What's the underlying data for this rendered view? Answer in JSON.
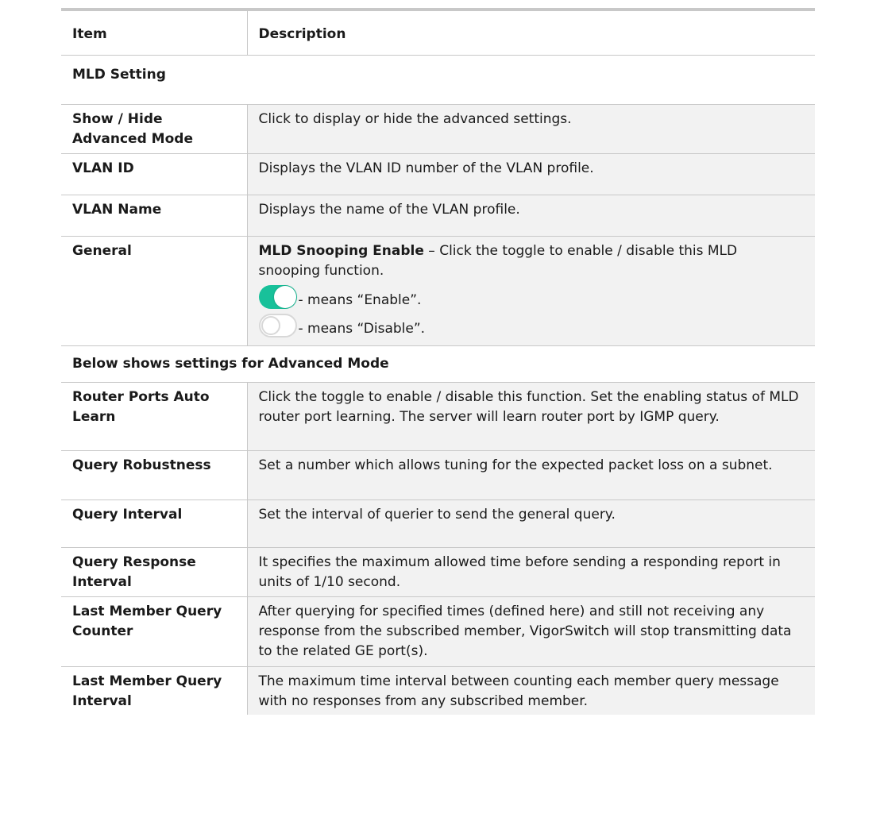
{
  "header": {
    "item": "Item",
    "description": "Description"
  },
  "sections": {
    "mld": "MLD Setting",
    "advanced": "Below shows settings for Advanced Mode"
  },
  "rows": [
    {
      "item": "Show / Hide Advanced Mode",
      "desc": "Click to display or hide the advanced settings."
    },
    {
      "item": "VLAN ID",
      "desc": "Displays the VLAN ID number of the VLAN profile."
    },
    {
      "item": "VLAN Name",
      "desc": "Displays the name of the VLAN profile."
    }
  ],
  "general": {
    "item": "General",
    "bold_label": "MLD Snooping Enable",
    "desc": " – Click the toggle to enable / disable this MLD snooping function.",
    "enable_text": "- means “Enable”.",
    "disable_text": "- means “Disable”.",
    "toggle_on_color": "#18c19a",
    "toggle_off_color": "#d8d8d8"
  },
  "advanced_rows": [
    {
      "item": "Router Ports Auto Learn",
      "desc": "Click the toggle to enable / disable this function. Set the enabling status of MLD router port learning. The server will learn router port by IGMP query."
    },
    {
      "item": "Query Robustness",
      "desc": "Set a number which allows tuning for the expected packet loss on a subnet."
    },
    {
      "item": "Query Interval",
      "desc": "Set the interval of querier to send the general query."
    },
    {
      "item": "Query Response Interval",
      "desc": "It specifies the maximum allowed time before sending a responding report in units of 1/10 second."
    },
    {
      "item": "Last Member Query Counter",
      "desc": "After querying for specified times (defined here) and still not receiving any response from the subscribed member, VigorSwitch will stop transmitting data to the related GE port(s)."
    },
    {
      "item": "Last Member Query Interval",
      "desc": "The maximum time interval between counting each member query message with no responses from any subscribed member."
    }
  ]
}
